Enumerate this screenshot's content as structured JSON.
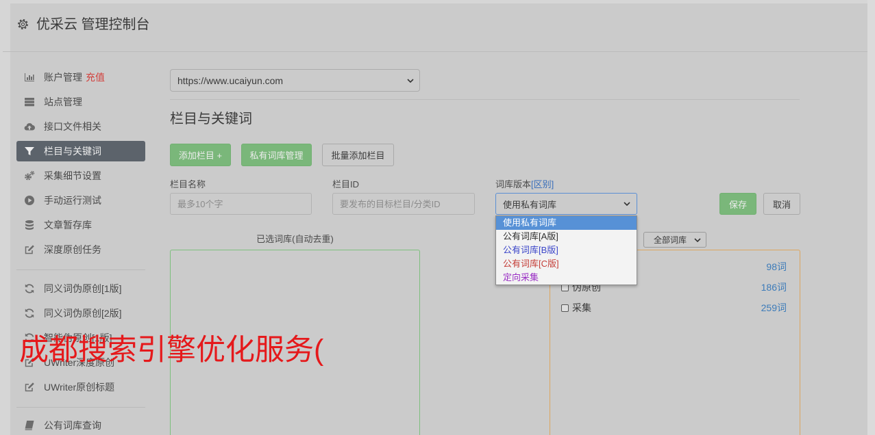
{
  "header": {
    "title": "优采云 管理控制台",
    "icon": "gear-icon"
  },
  "sidebar": {
    "items": [
      {
        "label": "账户管理",
        "badge": "充值",
        "icon": "bar-chart-icon"
      },
      {
        "label": "站点管理",
        "icon": "server-icon"
      },
      {
        "label": "接口文件相关",
        "icon": "cloud-upload-icon"
      },
      {
        "label": "栏目与关键词",
        "icon": "filter-icon",
        "active": true
      },
      {
        "label": "采集细节设置",
        "icon": "gears-icon"
      },
      {
        "label": "手动运行测试",
        "icon": "play-circle-icon"
      },
      {
        "label": "文章暂存库",
        "icon": "database-icon"
      },
      {
        "label": "深度原创任务",
        "icon": "edit-icon"
      },
      {
        "label": "同义词伪原创[1版]",
        "icon": "refresh-icon"
      },
      {
        "label": "同义词伪原创[2版]",
        "icon": "refresh-icon"
      },
      {
        "label": "智能伪原创[1版]",
        "icon": "refresh-icon"
      },
      {
        "label": "UWriter深度原创",
        "icon": "edit-icon"
      },
      {
        "label": "UWriter原创标题",
        "icon": "edit-icon"
      },
      {
        "label": "公有词库查询",
        "icon": "book-icon"
      }
    ]
  },
  "site_select": {
    "value": "https://www.ucaiyun.com"
  },
  "section_title": "栏目与关键词",
  "toolbar": {
    "add_column": "添加栏目 +",
    "private_lexicon": "私有词库管理",
    "batch_add": "批量添加栏目"
  },
  "form": {
    "name_label": "栏目名称",
    "name_placeholder": "最多10个字",
    "id_label": "栏目ID",
    "id_placeholder": "要发布的目标栏目/分类ID",
    "lexicon_label": "词库版本",
    "diff_link": "[区别]",
    "lexicon_value": "使用私有词库",
    "save": "保存",
    "cancel": "取消"
  },
  "lexicon_dropdown": {
    "options": [
      {
        "label": "使用私有词库",
        "selected": true
      },
      {
        "label": "公有词库[A版]",
        "color": "#2e2e2e"
      },
      {
        "label": "公有词库[B版]",
        "color": "#3b45c9"
      },
      {
        "label": "公有词库[C版]",
        "color": "#c43d37"
      },
      {
        "label": "定向采集",
        "color": "#9a2fc4"
      }
    ]
  },
  "selected_lexicons": {
    "title": "已选词库(自动去重)"
  },
  "all_lexicons": {
    "filter": "全部词库",
    "items": [
      {
        "count": "98词"
      },
      {
        "label": "伪原创",
        "count": "186词"
      },
      {
        "label": "采集",
        "count": "259词"
      }
    ]
  },
  "overlay_text": "成都搜索引擎优化服务(",
  "colors": {
    "recharge_badge": "#d2403c",
    "diff_link": "#3a6fbb",
    "lexicon_count": "#3c7bb9",
    "overlay_text": "#e5191b",
    "primary_button": "#7ab77a",
    "active_nav": "#5c636b",
    "selected_box_border": "#7dbf7d",
    "all_lexicons_box_border": "#dca55e",
    "focused_select_border": "#5a8fd4"
  }
}
